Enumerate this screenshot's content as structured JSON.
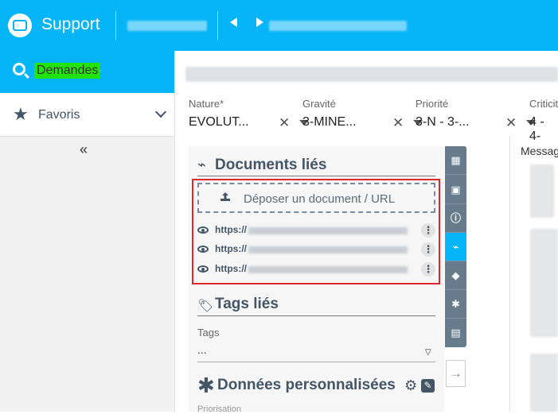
{
  "header": {
    "app_title": "Support",
    "brand_color": "#05b5f7"
  },
  "sidebar": {
    "active_item": "Demandes",
    "favorites_label": "Favoris",
    "collapse_glyph": "«"
  },
  "fields": [
    {
      "label": "Nature*",
      "value": "EVOLUT..."
    },
    {
      "label": "Gravité",
      "value": "3-MINE..."
    },
    {
      "label": "Priorité",
      "value": "3-N - 3-..."
    },
    {
      "label": "Criticit",
      "value": "4 - 4-"
    }
  ],
  "documents": {
    "title": "Documents liés",
    "upload_label": "Déposer un document / URL",
    "links": [
      "https://",
      "https://",
      "https://"
    ]
  },
  "tags": {
    "title": "Tags liés",
    "field_label": "Tags",
    "value": "..."
  },
  "custom_data": {
    "title": "Données personnalisées",
    "next_label": "Priorisation"
  },
  "right_panel": {
    "messages_label": "Messag"
  },
  "icons": {
    "search": "search-icon",
    "star": "star-icon",
    "clip": "paperclip-icon",
    "tag": "tag-icon",
    "asterisk": "asterisk-icon",
    "gear": "gear-icon",
    "edit": "edit-icon",
    "eye": "eye-icon"
  }
}
